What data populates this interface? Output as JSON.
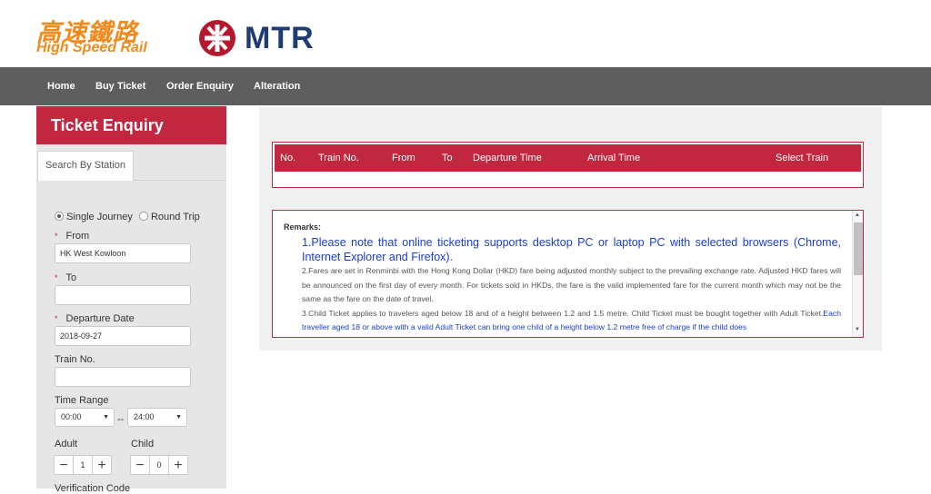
{
  "header": {
    "hsr_logo_cn": "高速鐵路",
    "hsr_logo_en": "High Speed Rail",
    "mtr_logo_text": "MTR"
  },
  "nav": {
    "items": [
      "Home",
      "Buy Ticket",
      "Order Enquiry",
      "Alteration"
    ]
  },
  "sidebar": {
    "title": "Ticket Enquiry",
    "tab": "Search By Station",
    "journey": {
      "single": "Single Journey",
      "round": "Round Trip",
      "selected": "single"
    },
    "from": {
      "label": "From",
      "value": "HK West Kowloon"
    },
    "to": {
      "label": "To",
      "value": ""
    },
    "departure_date": {
      "label": "Departure Date",
      "value": "2018-09-27"
    },
    "train_no": {
      "label": "Train No.",
      "value": ""
    },
    "time_range": {
      "label": "Time Range",
      "start": "00:00",
      "end": "24:00",
      "separator": "--"
    },
    "adult": {
      "label": "Adult",
      "value": "1"
    },
    "child": {
      "label": "Child",
      "value": "0"
    },
    "verification": {
      "label": "Verification Code"
    },
    "required_mark": "*",
    "minus": "−",
    "plus": "+"
  },
  "results": {
    "columns": [
      "No.",
      "Train No.",
      "From",
      "To",
      "Departure Time",
      "Arrival Time",
      "Select Train"
    ]
  },
  "remarks": {
    "title": "Remarks:",
    "item1": "1.Please note that online ticketing supports desktop PC or laptop PC with selected browsers (Chrome, Internet Explorer and Firefox).",
    "item2": "2.Fares are set in Renminbi with the Hong Kong Dollar (HKD) fare being adjusted monthly subject to the prevailing exchange rate. Adjusted HKD fares will be announced on the first day of every month. For tickets sold in HKDs, the fare is the valid implemented fare for the current month which may not be the same as the fare on the date of travel.",
    "item3": "3.Child Ticket applies to travelers aged below 18 and of a height between 1.2 and 1.5 metre. Child Ticket must be bought together with Adult Ticket.",
    "item3_blue": "Each traveller aged 18 or above with a valid Adult Ticket can bring one child of a height below 1.2 metre free of charge if the child does"
  },
  "colors": {
    "brand_red": "#c1273f",
    "nav_gray": "#5e5e5e",
    "hsr_orange": "#f08a1d",
    "mtr_red": "#b5172f",
    "mtr_blue": "#1f3b73",
    "link_blue": "#1a3fc4"
  }
}
